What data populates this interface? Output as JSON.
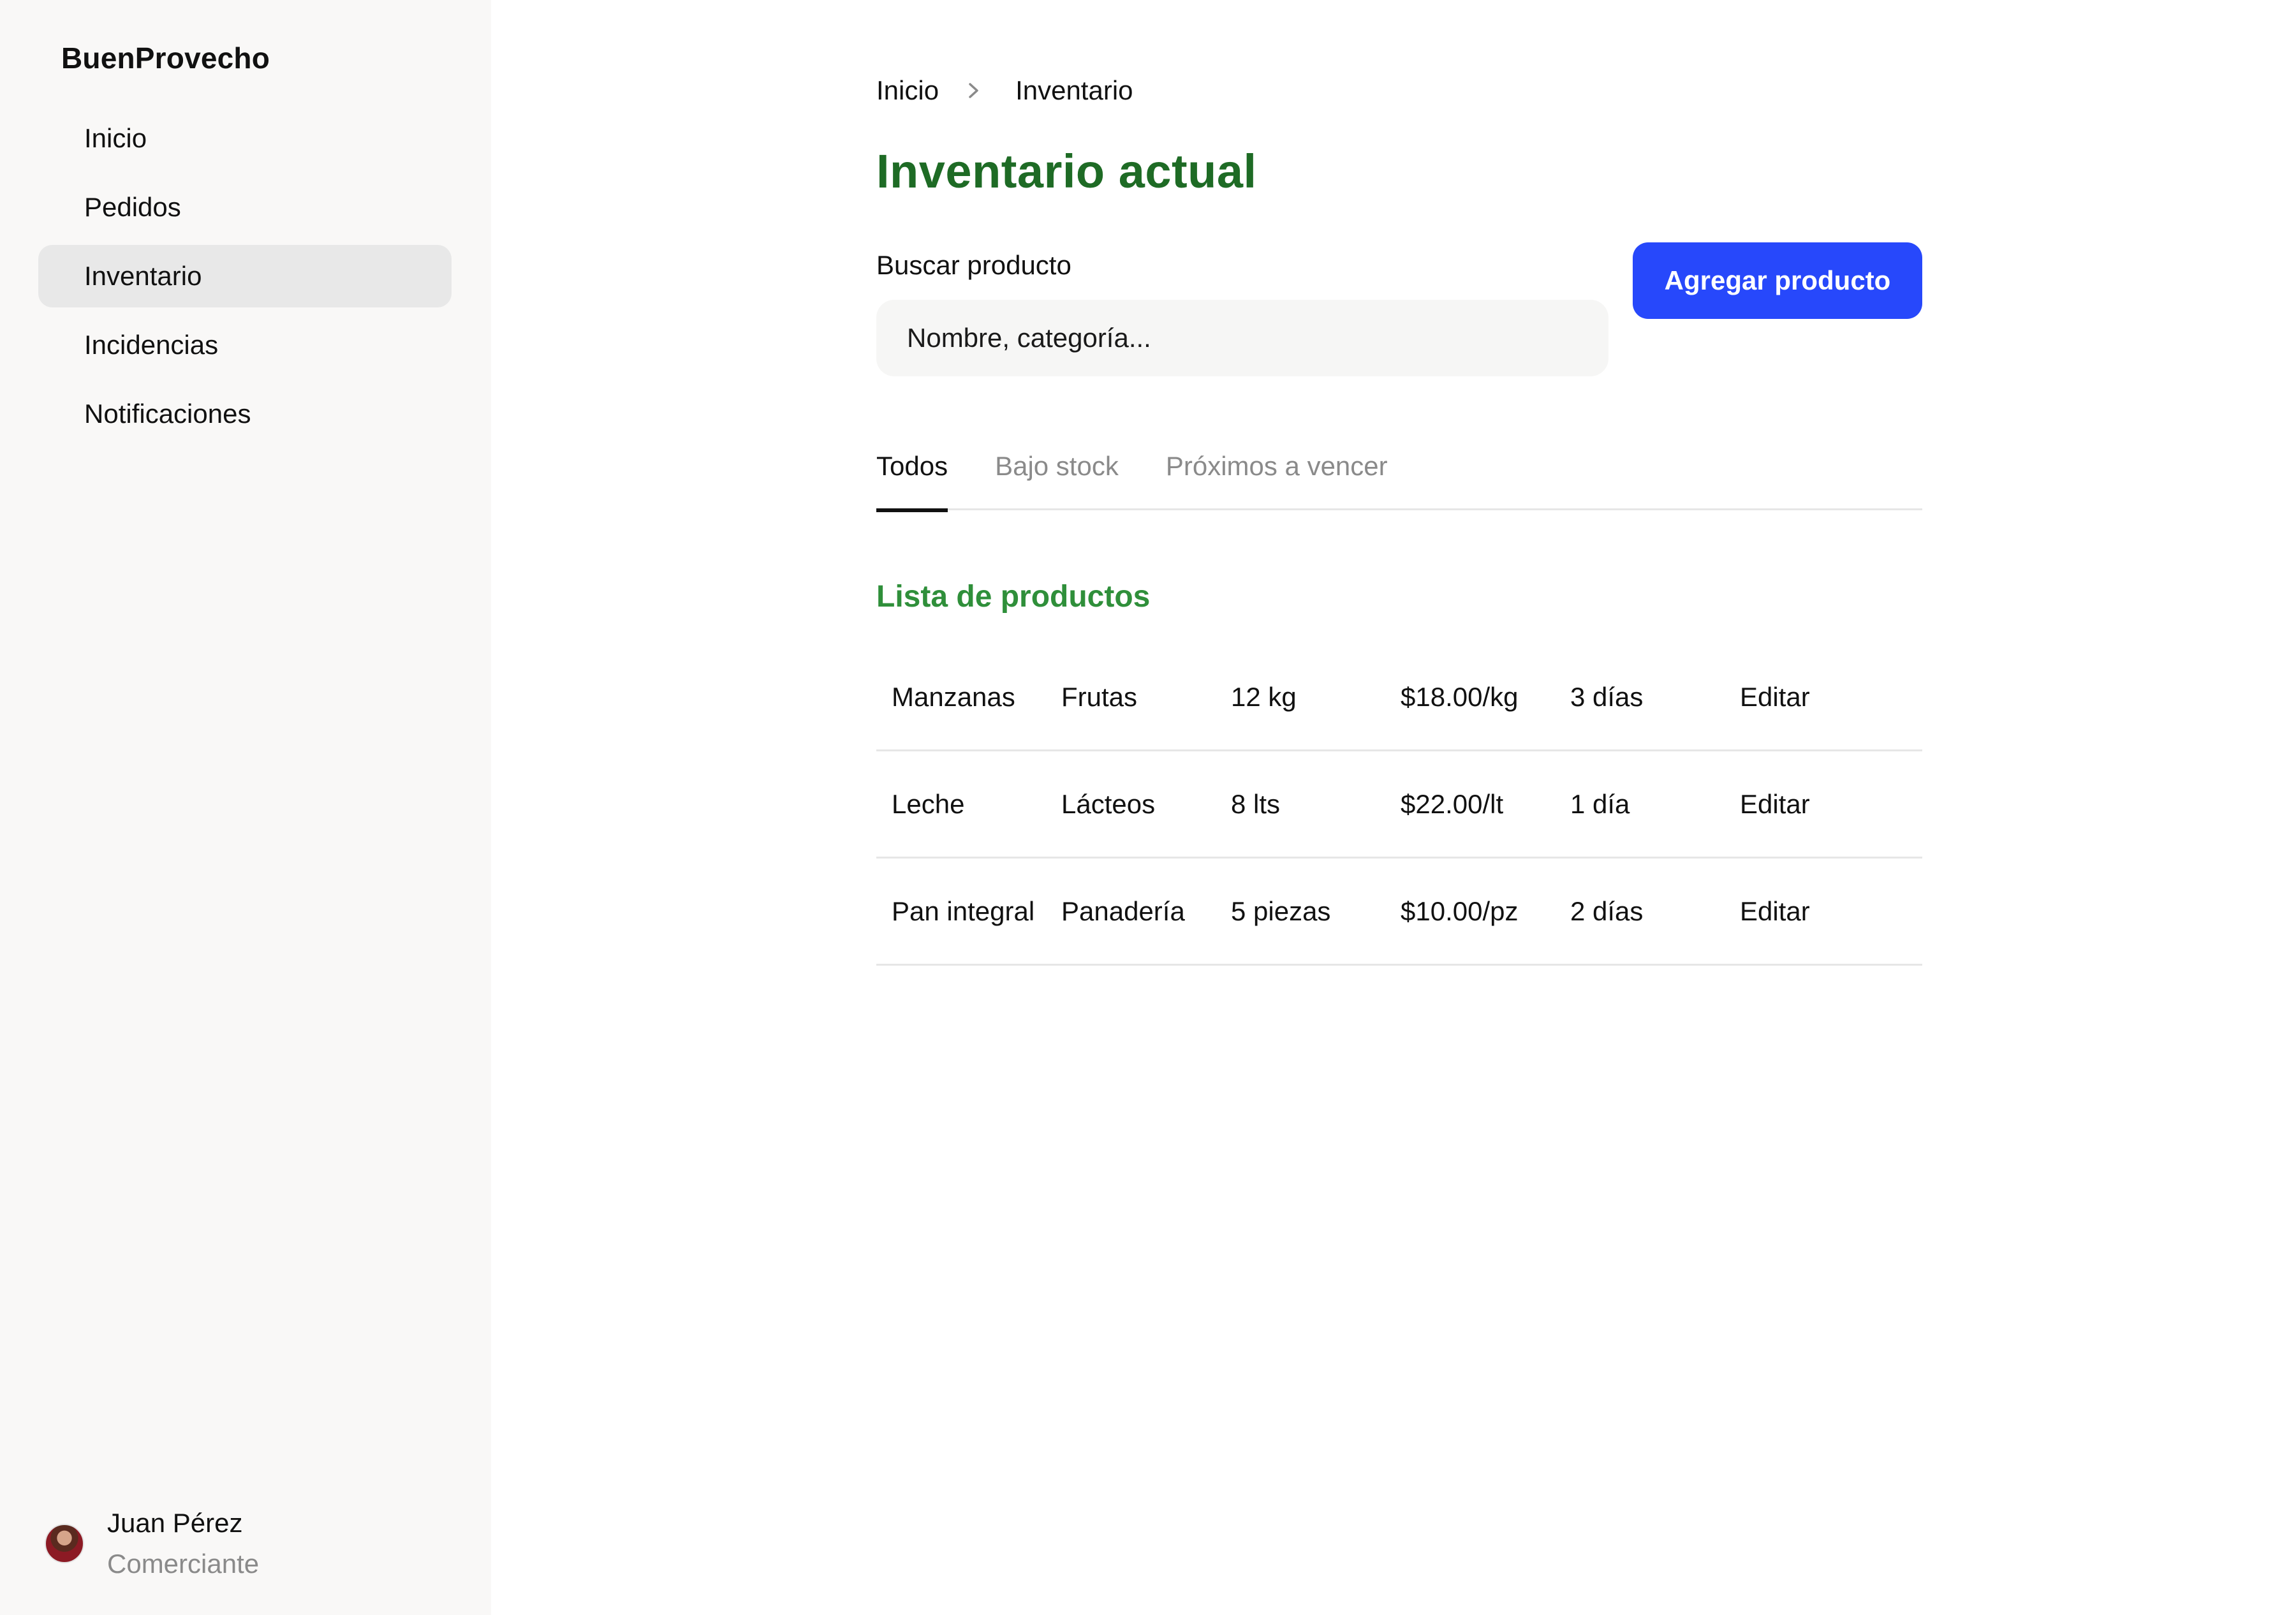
{
  "sidebar": {
    "brand": "BuenProvecho",
    "items": [
      {
        "label": "Inicio"
      },
      {
        "label": "Pedidos"
      },
      {
        "label": "Inventario"
      },
      {
        "label": "Incidencias"
      },
      {
        "label": "Notificaciones"
      }
    ],
    "active_item": "Inventario",
    "user": {
      "name": "Juan Pérez",
      "role": "Comerciante"
    }
  },
  "breadcrumb": {
    "home": "Inicio",
    "current": "Inventario"
  },
  "page": {
    "title": "Inventario actual"
  },
  "search": {
    "label": "Buscar producto",
    "placeholder": "Nombre, categoría...",
    "value": ""
  },
  "actions": {
    "add_label": "Agregar producto"
  },
  "tabs": [
    {
      "label": "Todos"
    },
    {
      "label": "Bajo stock"
    },
    {
      "label": "Próximos a vencer"
    }
  ],
  "active_tab": "Todos",
  "products": {
    "section_title": "Lista de productos",
    "rows": [
      {
        "name": "Manzanas",
        "category": "Frutas",
        "quantity": "12 kg",
        "price": "$18.00/kg",
        "expires": "3 días",
        "action": "Editar"
      },
      {
        "name": "Leche",
        "category": "Lácteos",
        "quantity": "8 lts",
        "price": "$22.00/lt",
        "expires": "1 día",
        "action": "Editar"
      },
      {
        "name": "Pan integral",
        "category": "Panadería",
        "quantity": "5 piezas",
        "price": "$10.00/pz",
        "expires": "2 días",
        "action": "Editar"
      }
    ]
  },
  "colors": {
    "accent_button": "#2748fb",
    "title_green": "#1e6b25",
    "section_green": "#2f8f3a",
    "sidebar_bg": "#f9f8f7",
    "active_nav_bg": "#e8e8e8"
  }
}
